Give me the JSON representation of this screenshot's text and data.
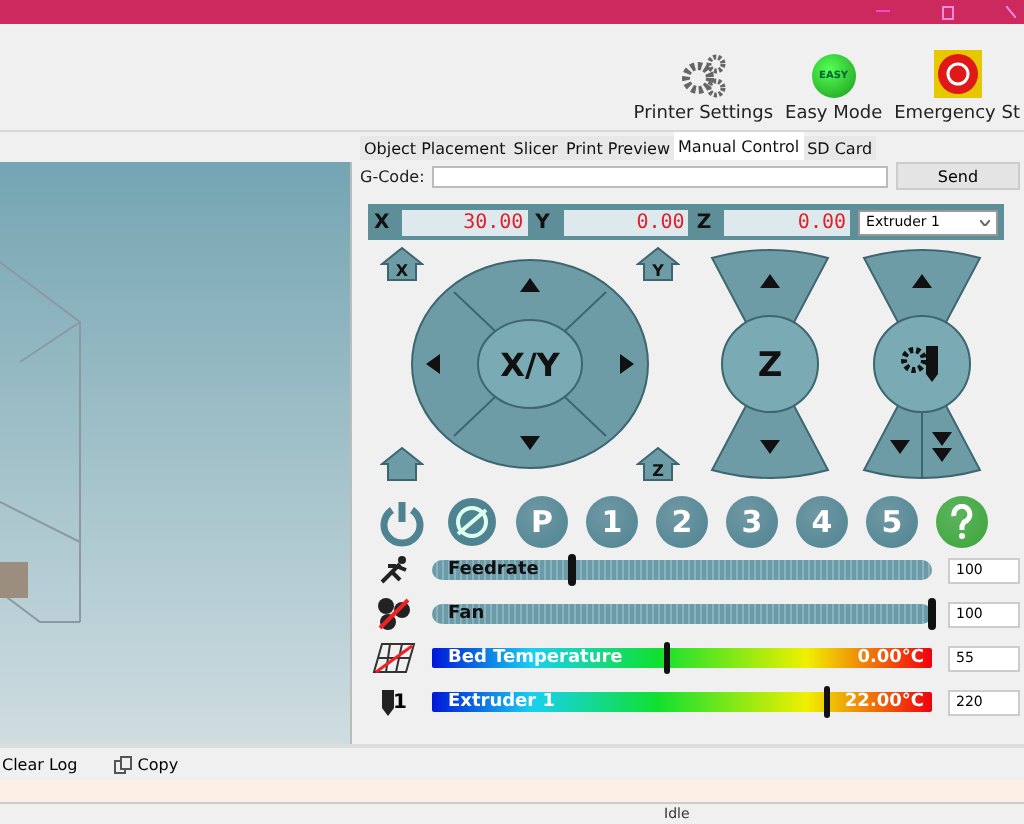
{
  "toolbar": {
    "buttons": [
      {
        "kind": "gears",
        "label": "Printer Settings"
      },
      {
        "kind": "easy",
        "label": "Easy Mode",
        "badge": "EASY"
      },
      {
        "kind": "stop",
        "label": "Emergency St"
      }
    ]
  },
  "tabs": [
    {
      "label": "Object Placement",
      "selected": false
    },
    {
      "label": "Slicer",
      "selected": false
    },
    {
      "label": "Print Preview",
      "selected": false
    },
    {
      "label": "Manual Control",
      "selected": true
    },
    {
      "label": "SD Card",
      "selected": false
    }
  ],
  "gcode": {
    "label": "G-Code:",
    "send": "Send"
  },
  "coordinates": [
    {
      "axis": "X",
      "value": "30.00"
    },
    {
      "axis": "Y",
      "value": "0.00"
    },
    {
      "axis": "Z",
      "value": "0.00"
    }
  ],
  "extruder_select": "Extruder 1",
  "jog": {
    "xy_label": "X/Y",
    "z_label": "Z",
    "home_x": "X",
    "home_y": "Y",
    "home_z": "Z"
  },
  "action_buttons": [
    {
      "kind": "power"
    },
    {
      "kind": "fan-off"
    },
    {
      "kind": "text",
      "text": "P"
    },
    {
      "kind": "text",
      "text": "1"
    },
    {
      "kind": "text",
      "text": "2"
    },
    {
      "kind": "text",
      "text": "3"
    },
    {
      "kind": "text",
      "text": "4"
    },
    {
      "kind": "text",
      "text": "5"
    },
    {
      "kind": "help"
    }
  ],
  "sliders": [
    {
      "kind": "feedrate",
      "label": "Feedrate",
      "level": 0.28,
      "value": "100"
    },
    {
      "kind": "fan",
      "label": "Fan",
      "level": 1.0,
      "value": "100"
    },
    {
      "kind": "bed",
      "label": "Bed Temperature",
      "level": 0.47,
      "reading": "0.00°C",
      "value": "55"
    },
    {
      "kind": "extruder",
      "label": "Extruder 1",
      "icon_text": "1",
      "level": 0.79,
      "reading": "22.00°C",
      "value": "220"
    }
  ],
  "log_toolbar": {
    "clear": "Clear Log",
    "copy": "Copy"
  },
  "status_bar": {
    "state": "Idle"
  }
}
